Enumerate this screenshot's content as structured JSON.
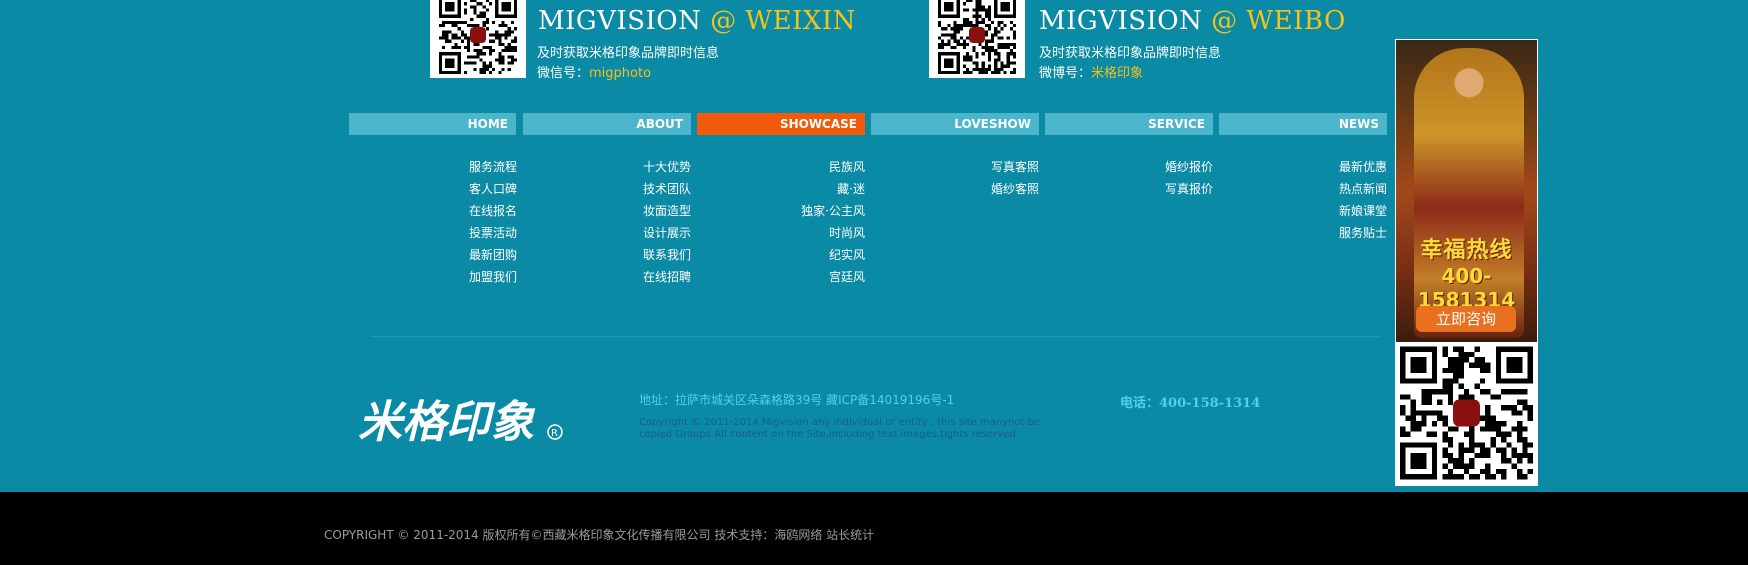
{
  "weixin": {
    "title_prefix": "MIGVISION",
    "title_at": "@ WEIXIN",
    "line1": "及时获取米格印象品牌即时信息",
    "line2_label": "微信号：",
    "line2_value": "migphoto"
  },
  "weibo": {
    "title_prefix": "MIGVISION",
    "title_at": "@ WEIBO",
    "line1": "及时获取米格印象品牌即时信息",
    "line2_label": "微博号：",
    "line2_value": "米格印象"
  },
  "nav": {
    "tabs": [
      {
        "label": "HOME"
      },
      {
        "label": "ABOUT"
      },
      {
        "label": "SHOWCASE"
      },
      {
        "label": "LOVESHOW"
      },
      {
        "label": "SERVICE"
      },
      {
        "label": "NEWS"
      }
    ],
    "columns": [
      [
        "服务流程",
        "客人口碑",
        "在线报名",
        "投票活动",
        "最新团购",
        "加盟我们"
      ],
      [
        "十大优势",
        "技术团队",
        "妆面造型",
        "设计展示",
        "联系我们",
        "在线招聘"
      ],
      [
        "民族风",
        "藏·迷",
        "独家·公主风",
        "时尚风",
        "纪实风",
        "宫廷风"
      ],
      [
        "写真客照",
        "婚纱客照"
      ],
      [
        "婚纱报价",
        "写真报价"
      ],
      [
        "最新优惠",
        "热点新闻",
        "新娘课堂",
        "服务贴士"
      ]
    ]
  },
  "footer": {
    "logo_text": "米格印象",
    "address": "地址：拉萨市城关区朵森格路39号 藏ICP备14019196号-1",
    "copyright_en": "Copyright © 2011-2014 Migvision any individual or entity , this site manynot be copied Groups All content on the Site,including text,images,tights reserved",
    "tel": "电话：400-158-1314",
    "bottom_copyright": "COPYRIGHT © 2011-2014 版权所有©西藏米格印象文化传播有限公司 技术支持：海鸥网络 站长统计"
  },
  "ad": {
    "hotline": "幸福热线",
    "phone": "400-1581314",
    "consult_label": "立即咨询"
  },
  "colors": {
    "background_teal": "#0b8aa5",
    "nav_tab": "#4bb5cc",
    "nav_active": "#f15a0a",
    "accent_yellow": "#f3c21b",
    "bottom_bar": "#000000"
  }
}
